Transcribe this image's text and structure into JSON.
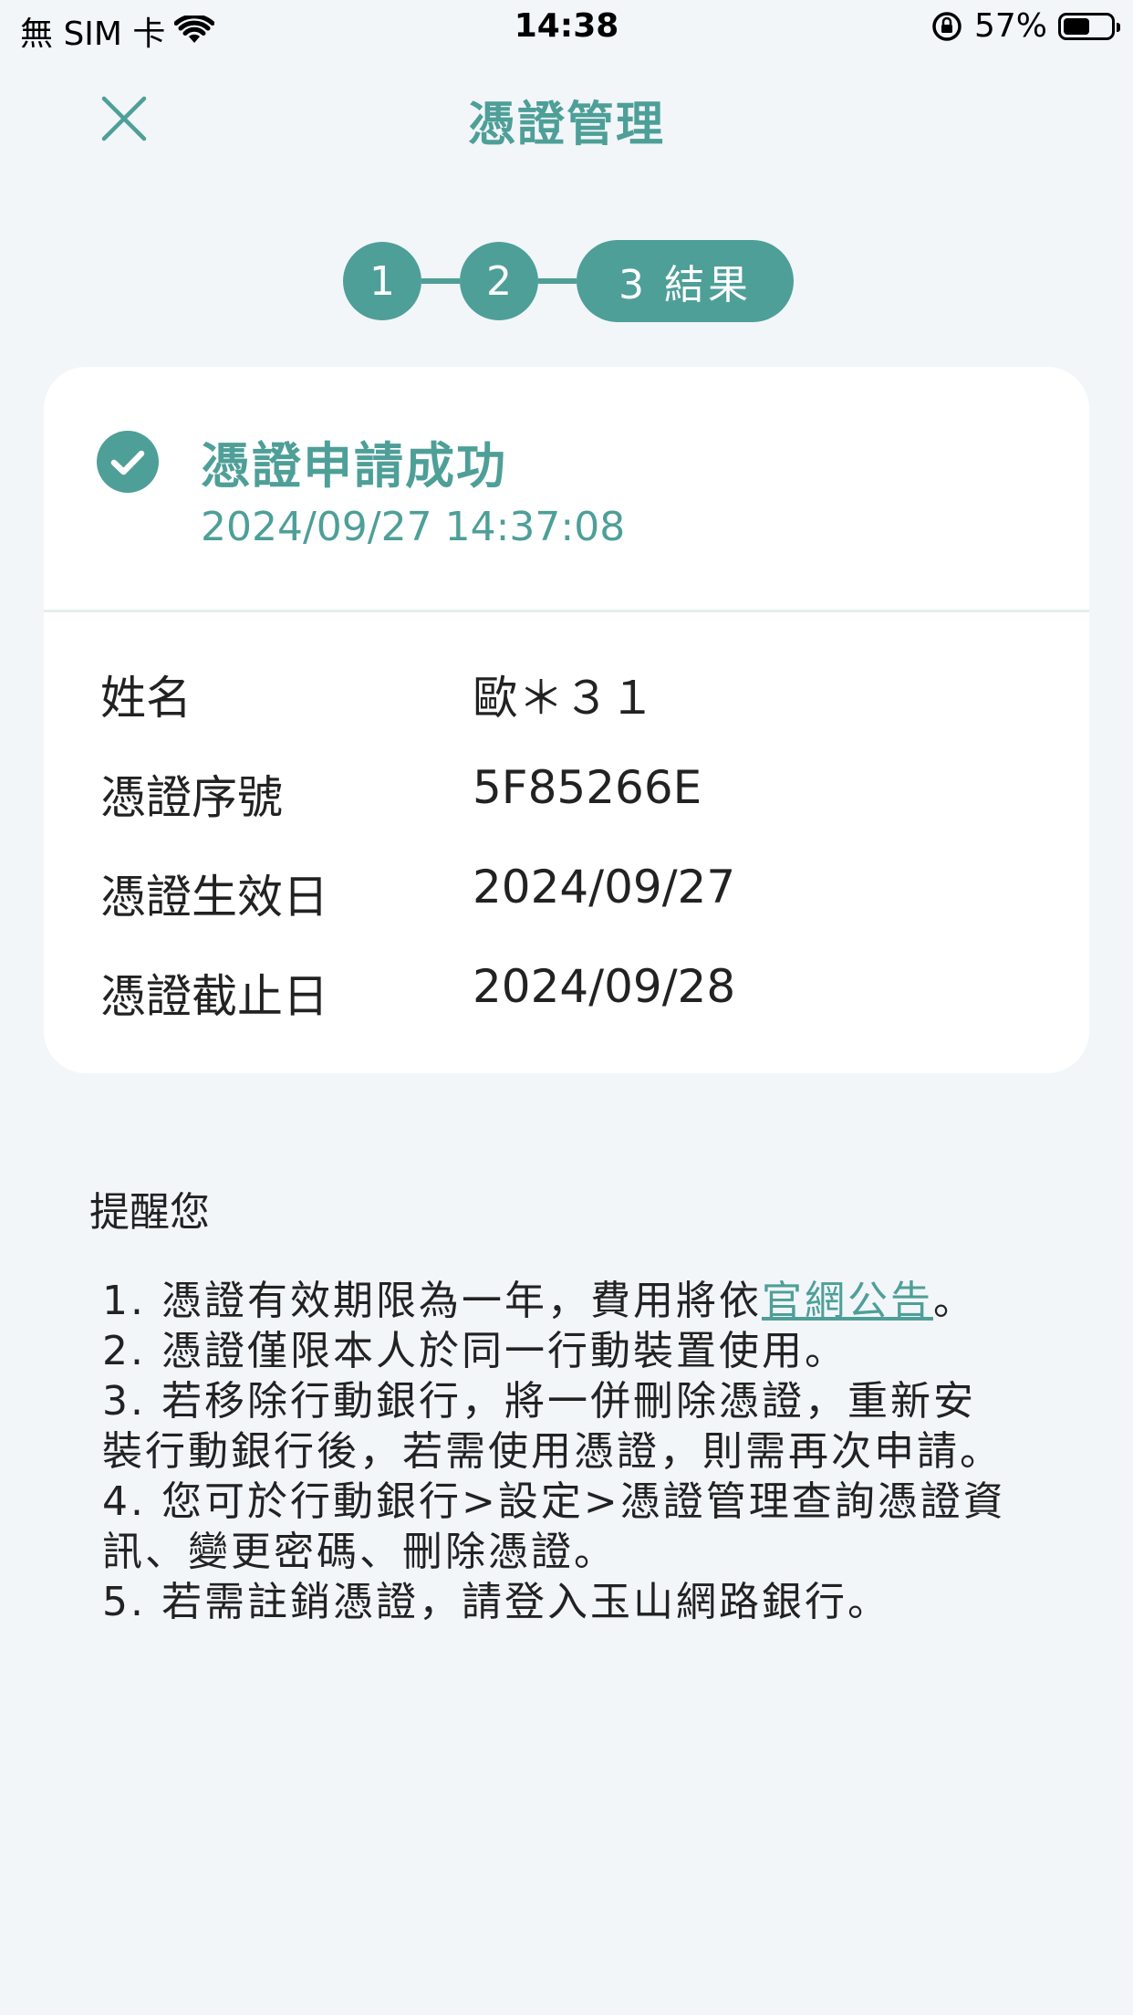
{
  "status_bar": {
    "carrier": "無 SIM 卡",
    "time": "14:38",
    "battery_percent": "57%",
    "battery_level": 0.57
  },
  "header": {
    "title": "憑證管理",
    "close_icon": "close-icon"
  },
  "stepper": {
    "step1": "1",
    "step2": "2",
    "step3": "3 結果",
    "current_step": 3
  },
  "result": {
    "title": "憑證申請成功",
    "timestamp": "2024/09/27 14:37:08",
    "rows": [
      {
        "label": "姓名",
        "value": "歐＊３１"
      },
      {
        "label": "憑證序號",
        "value": "5F85266E"
      },
      {
        "label": "憑證生效日",
        "value": "2024/09/27"
      },
      {
        "label": "憑證截止日",
        "value": "2024/09/28"
      }
    ]
  },
  "reminder": {
    "title": "提醒您",
    "item1_prefix": "1. 憑證有效期限為一年，費用將依",
    "item1_link": "官網公告",
    "item1_suffix": "。",
    "item2": "2. 憑證僅限本人於同一行動裝置使用。",
    "item3": "3. 若移除行動銀行，將一併刪除憑證，重新安裝行動銀行後，若需使用憑證，則需再次申請。",
    "item4": "4. 您可於行動銀行>設定>憑證管理查詢憑證資訊、變更密碼、刪除憑證。",
    "item5": "5. 若需註銷憑證，請登入玉山網路銀行。"
  },
  "colors": {
    "accent": "#4e9f98",
    "background": "#f2f6f9"
  }
}
